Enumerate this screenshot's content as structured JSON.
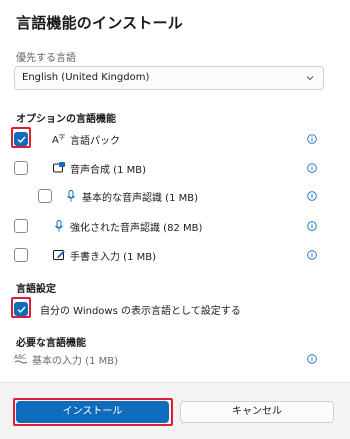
{
  "dialog": {
    "title": "言語機能のインストール",
    "preferred_label": "優先する言語",
    "preferred_value": "English (United Kingdom)"
  },
  "optional": {
    "heading": "オプションの言語機能",
    "items": [
      {
        "label": "言語パック",
        "checked": true
      },
      {
        "label": "音声合成 (1 MB)",
        "checked": false
      },
      {
        "label": "基本的な音声認識 (1 MB)",
        "checked": false
      },
      {
        "label": "強化された音声認識 (82 MB)",
        "checked": false
      },
      {
        "label": "手書き入力 (1 MB)",
        "checked": false
      }
    ]
  },
  "settings": {
    "heading": "言語設定",
    "display_label": "自分の Windows の表示言語として設定する",
    "checked": true
  },
  "required": {
    "heading": "必要な言語機能",
    "basic_input": "基本の入力 (1 MB)"
  },
  "footer": {
    "install_label": "インストール",
    "cancel_label": "キャンセル"
  },
  "colors": {
    "accent": "#0f6cbd",
    "highlight": "#d82034"
  }
}
